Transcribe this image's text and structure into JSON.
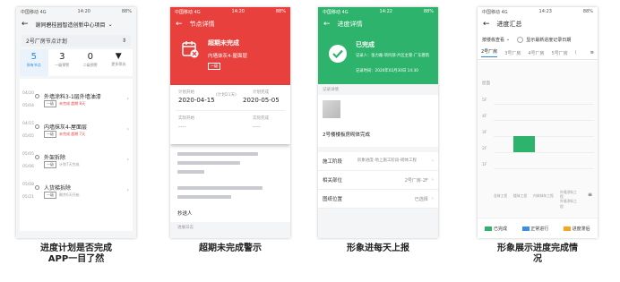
{
  "status": {
    "left": "中国移动 4G",
    "time": "14:20",
    "time2": "14:22",
    "time3": "14:23",
    "right": "88%"
  },
  "phone1": {
    "project": "谢同碧桂园智造创新中心项目",
    "select_value": "2号厂房节点计划",
    "stats": [
      {
        "num": "5",
        "label": "所有节点"
      },
      {
        "num": "3",
        "label": "一级预警"
      },
      {
        "num": "0",
        "label": "二级预警"
      },
      {
        "num": "",
        "label": "更多筛选"
      }
    ],
    "items": [
      {
        "date1": "04/20",
        "date2": "05/04",
        "title": "外墙涂料3-1层外墙油漆",
        "tag": "一级",
        "status": "未完成 超期 8天",
        "status_color": "#e8403d"
      },
      {
        "date1": "04/15",
        "date2": "05/05",
        "title": "内墙抹灰4-屋面层",
        "tag": "一级",
        "status": "未完成 超期 7天",
        "status_color": "#e8403d"
      },
      {
        "date1": "05/05",
        "date2": "05/06",
        "title": "外架拆除",
        "tag": "一级",
        "status": "计划7天完成",
        "status_color": "#999999"
      },
      {
        "date1": "05/08",
        "date2": "05/21",
        "title": "人货梯拆除",
        "tag": "一级",
        "status": "剩余6天开始",
        "status_color": "#999999"
      }
    ]
  },
  "phone2": {
    "title": "节点详情",
    "alert": "超期未完成",
    "node": "内墙抹灰4-屋面层",
    "tag": "一级",
    "plan_start_label": "计划开始",
    "plan_days": "(计划21天)",
    "plan_end_label": "计划完成",
    "plan_start": "2020-04-15",
    "plan_end": "2020-05-05",
    "actual_start_label": "实际开始",
    "actual_end_label": "实际完成",
    "actual_start": "----",
    "actual_end": "----",
    "cc_label": "抄送人",
    "log_label": "进展日志"
  },
  "phone3": {
    "title": "进度详情",
    "done": "已完成",
    "recorder": "记录人：张力雅-项目部-片区主管-广东建筑",
    "record_time": "记录时间：2020年02月30日 14:30",
    "section": "记录详情",
    "desc": "2号楼楼板房砌体完成",
    "rows": [
      {
        "label": "施工阶段",
        "value": "房象进度-地上施工阶段-砌体工程"
      },
      {
        "label": "相关部位",
        "value": "2号厂房-2F"
      },
      {
        "label": "图纸位置",
        "value": "已选择"
      }
    ]
  },
  "phone4": {
    "title": "进度汇总",
    "filter": "按楼栋查看",
    "toggle": "显示最新进度记录日期",
    "tabs": [
      "2号厂房",
      "3号厂房",
      "4号厂房",
      "5号厂房",
      "("
    ],
    "roof_label": "屋面",
    "floors": [
      "5F",
      "4F",
      "3F",
      "2F",
      "1F"
    ],
    "x_labels": [
      "含体工程",
      "楼体工程",
      "内体抹灰工程",
      "外墙涂料工程",
      "外墙涂料工程"
    ],
    "legend": [
      {
        "label": "已完成",
        "color": "#2db36b"
      },
      {
        "label": "正常进行",
        "color": "#3a8ee6"
      },
      {
        "label": "进度滞后",
        "color": "#f5a623"
      }
    ]
  },
  "captions": {
    "c1": "进度计划是否完成",
    "c1b": "APP一目了然",
    "c2": "超期未完成警示",
    "c3": "形象进每天上报",
    "c4": "形象展示进度完成情",
    "c4b": "况"
  }
}
